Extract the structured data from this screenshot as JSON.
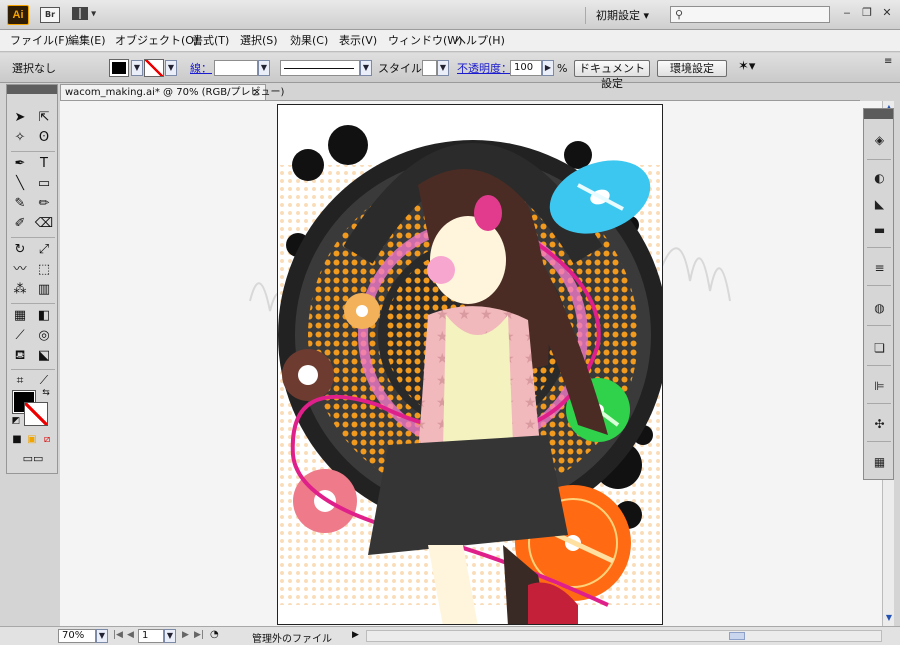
{
  "titlebar": {
    "app_icon": "Ai",
    "bridge_icon": "Br",
    "workspace": "初期設定",
    "search_placeholder": "",
    "minimize": "‒",
    "restore": "❐",
    "close": "✕"
  },
  "menu": {
    "items": [
      "ファイル(F)",
      "編集(E)",
      "オブジェクト(O)",
      "書式(T)",
      "選択(S)",
      "効果(C)",
      "表示(V)",
      "ウィンドウ(W)",
      "ヘルプ(H)"
    ]
  },
  "control": {
    "selection": "選択なし",
    "stroke_label": "線：",
    "style_label": "スタイル：",
    "opacity_label": "不透明度：",
    "opacity_value": "100",
    "percent": "%",
    "doc_setup": "ドキュメント設定",
    "preferences": "環境設定"
  },
  "document": {
    "tab_title": "wacom_making.ai* @ 70% (RGB/プレビュー)",
    "close": "×"
  },
  "status": {
    "zoom": "70%",
    "page": "1",
    "info": "管理外のファイル"
  },
  "colors": {
    "accent": "#f4a300",
    "cd_cyan": "#3cc7f0",
    "cd_green": "#2fd24a",
    "cd_orange": "#ff6a12",
    "cable_magenta": "#e0208a",
    "halftone_orange": "#f29a1e"
  }
}
